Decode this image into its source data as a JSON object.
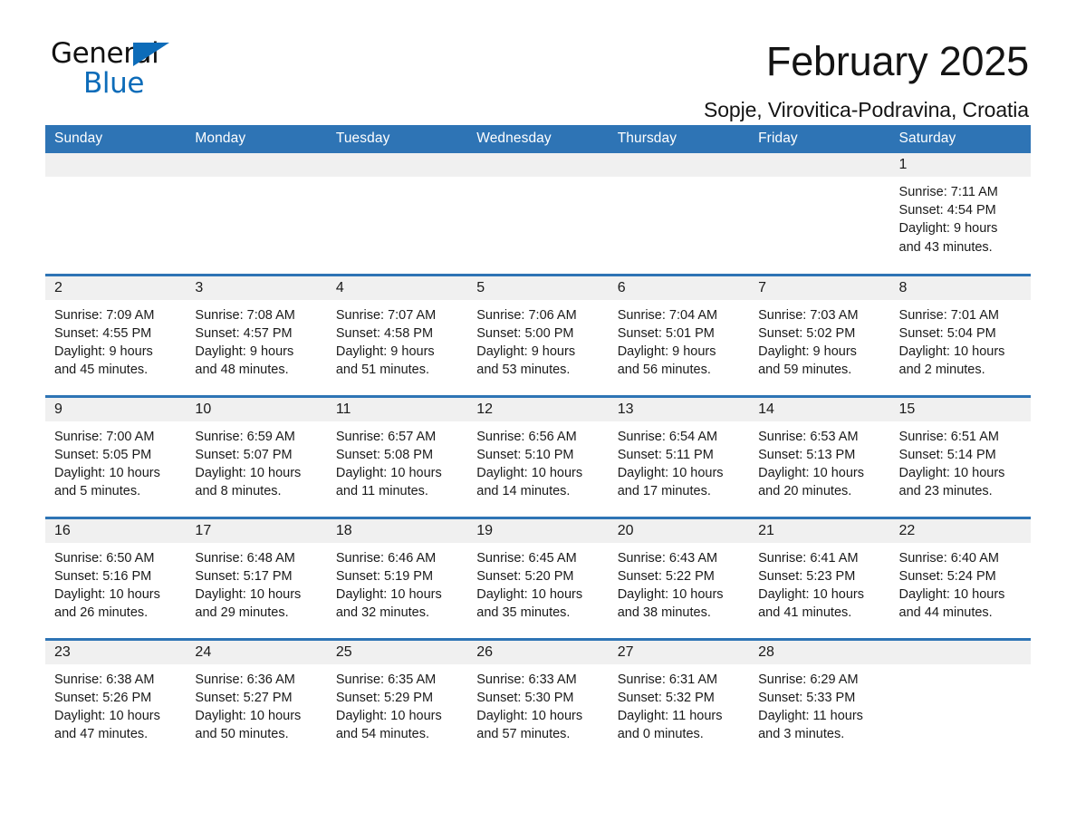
{
  "brand": {
    "word_one": "General",
    "word_two": "Blue",
    "accent_color": "#0d6cb9"
  },
  "header": {
    "title": "February 2025",
    "location": "Sopje, Virovitica-Podravina, Croatia",
    "header_bg_color": "#2e74b5",
    "daynum_band_color": "#f0f0f0"
  },
  "weekday_headers": [
    "Sunday",
    "Monday",
    "Tuesday",
    "Wednesday",
    "Thursday",
    "Friday",
    "Saturday"
  ],
  "weeks": [
    [
      {
        "day": "",
        "sunrise": "",
        "sunset": "",
        "daylight_line1": "",
        "daylight_line2": ""
      },
      {
        "day": "",
        "sunrise": "",
        "sunset": "",
        "daylight_line1": "",
        "daylight_line2": ""
      },
      {
        "day": "",
        "sunrise": "",
        "sunset": "",
        "daylight_line1": "",
        "daylight_line2": ""
      },
      {
        "day": "",
        "sunrise": "",
        "sunset": "",
        "daylight_line1": "",
        "daylight_line2": ""
      },
      {
        "day": "",
        "sunrise": "",
        "sunset": "",
        "daylight_line1": "",
        "daylight_line2": ""
      },
      {
        "day": "",
        "sunrise": "",
        "sunset": "",
        "daylight_line1": "",
        "daylight_line2": ""
      },
      {
        "day": "1",
        "sunrise": "Sunrise: 7:11 AM",
        "sunset": "Sunset: 4:54 PM",
        "daylight_line1": "Daylight: 9 hours",
        "daylight_line2": "and 43 minutes."
      }
    ],
    [
      {
        "day": "2",
        "sunrise": "Sunrise: 7:09 AM",
        "sunset": "Sunset: 4:55 PM",
        "daylight_line1": "Daylight: 9 hours",
        "daylight_line2": "and 45 minutes."
      },
      {
        "day": "3",
        "sunrise": "Sunrise: 7:08 AM",
        "sunset": "Sunset: 4:57 PM",
        "daylight_line1": "Daylight: 9 hours",
        "daylight_line2": "and 48 minutes."
      },
      {
        "day": "4",
        "sunrise": "Sunrise: 7:07 AM",
        "sunset": "Sunset: 4:58 PM",
        "daylight_line1": "Daylight: 9 hours",
        "daylight_line2": "and 51 minutes."
      },
      {
        "day": "5",
        "sunrise": "Sunrise: 7:06 AM",
        "sunset": "Sunset: 5:00 PM",
        "daylight_line1": "Daylight: 9 hours",
        "daylight_line2": "and 53 minutes."
      },
      {
        "day": "6",
        "sunrise": "Sunrise: 7:04 AM",
        "sunset": "Sunset: 5:01 PM",
        "daylight_line1": "Daylight: 9 hours",
        "daylight_line2": "and 56 minutes."
      },
      {
        "day": "7",
        "sunrise": "Sunrise: 7:03 AM",
        "sunset": "Sunset: 5:02 PM",
        "daylight_line1": "Daylight: 9 hours",
        "daylight_line2": "and 59 minutes."
      },
      {
        "day": "8",
        "sunrise": "Sunrise: 7:01 AM",
        "sunset": "Sunset: 5:04 PM",
        "daylight_line1": "Daylight: 10 hours",
        "daylight_line2": "and 2 minutes."
      }
    ],
    [
      {
        "day": "9",
        "sunrise": "Sunrise: 7:00 AM",
        "sunset": "Sunset: 5:05 PM",
        "daylight_line1": "Daylight: 10 hours",
        "daylight_line2": "and 5 minutes."
      },
      {
        "day": "10",
        "sunrise": "Sunrise: 6:59 AM",
        "sunset": "Sunset: 5:07 PM",
        "daylight_line1": "Daylight: 10 hours",
        "daylight_line2": "and 8 minutes."
      },
      {
        "day": "11",
        "sunrise": "Sunrise: 6:57 AM",
        "sunset": "Sunset: 5:08 PM",
        "daylight_line1": "Daylight: 10 hours",
        "daylight_line2": "and 11 minutes."
      },
      {
        "day": "12",
        "sunrise": "Sunrise: 6:56 AM",
        "sunset": "Sunset: 5:10 PM",
        "daylight_line1": "Daylight: 10 hours",
        "daylight_line2": "and 14 minutes."
      },
      {
        "day": "13",
        "sunrise": "Sunrise: 6:54 AM",
        "sunset": "Sunset: 5:11 PM",
        "daylight_line1": "Daylight: 10 hours",
        "daylight_line2": "and 17 minutes."
      },
      {
        "day": "14",
        "sunrise": "Sunrise: 6:53 AM",
        "sunset": "Sunset: 5:13 PM",
        "daylight_line1": "Daylight: 10 hours",
        "daylight_line2": "and 20 minutes."
      },
      {
        "day": "15",
        "sunrise": "Sunrise: 6:51 AM",
        "sunset": "Sunset: 5:14 PM",
        "daylight_line1": "Daylight: 10 hours",
        "daylight_line2": "and 23 minutes."
      }
    ],
    [
      {
        "day": "16",
        "sunrise": "Sunrise: 6:50 AM",
        "sunset": "Sunset: 5:16 PM",
        "daylight_line1": "Daylight: 10 hours",
        "daylight_line2": "and 26 minutes."
      },
      {
        "day": "17",
        "sunrise": "Sunrise: 6:48 AM",
        "sunset": "Sunset: 5:17 PM",
        "daylight_line1": "Daylight: 10 hours",
        "daylight_line2": "and 29 minutes."
      },
      {
        "day": "18",
        "sunrise": "Sunrise: 6:46 AM",
        "sunset": "Sunset: 5:19 PM",
        "daylight_line1": "Daylight: 10 hours",
        "daylight_line2": "and 32 minutes."
      },
      {
        "day": "19",
        "sunrise": "Sunrise: 6:45 AM",
        "sunset": "Sunset: 5:20 PM",
        "daylight_line1": "Daylight: 10 hours",
        "daylight_line2": "and 35 minutes."
      },
      {
        "day": "20",
        "sunrise": "Sunrise: 6:43 AM",
        "sunset": "Sunset: 5:22 PM",
        "daylight_line1": "Daylight: 10 hours",
        "daylight_line2": "and 38 minutes."
      },
      {
        "day": "21",
        "sunrise": "Sunrise: 6:41 AM",
        "sunset": "Sunset: 5:23 PM",
        "daylight_line1": "Daylight: 10 hours",
        "daylight_line2": "and 41 minutes."
      },
      {
        "day": "22",
        "sunrise": "Sunrise: 6:40 AM",
        "sunset": "Sunset: 5:24 PM",
        "daylight_line1": "Daylight: 10 hours",
        "daylight_line2": "and 44 minutes."
      }
    ],
    [
      {
        "day": "23",
        "sunrise": "Sunrise: 6:38 AM",
        "sunset": "Sunset: 5:26 PM",
        "daylight_line1": "Daylight: 10 hours",
        "daylight_line2": "and 47 minutes."
      },
      {
        "day": "24",
        "sunrise": "Sunrise: 6:36 AM",
        "sunset": "Sunset: 5:27 PM",
        "daylight_line1": "Daylight: 10 hours",
        "daylight_line2": "and 50 minutes."
      },
      {
        "day": "25",
        "sunrise": "Sunrise: 6:35 AM",
        "sunset": "Sunset: 5:29 PM",
        "daylight_line1": "Daylight: 10 hours",
        "daylight_line2": "and 54 minutes."
      },
      {
        "day": "26",
        "sunrise": "Sunrise: 6:33 AM",
        "sunset": "Sunset: 5:30 PM",
        "daylight_line1": "Daylight: 10 hours",
        "daylight_line2": "and 57 minutes."
      },
      {
        "day": "27",
        "sunrise": "Sunrise: 6:31 AM",
        "sunset": "Sunset: 5:32 PM",
        "daylight_line1": "Daylight: 11 hours",
        "daylight_line2": "and 0 minutes."
      },
      {
        "day": "28",
        "sunrise": "Sunrise: 6:29 AM",
        "sunset": "Sunset: 5:33 PM",
        "daylight_line1": "Daylight: 11 hours",
        "daylight_line2": "and 3 minutes."
      },
      {
        "day": "",
        "sunrise": "",
        "sunset": "",
        "daylight_line1": "",
        "daylight_line2": ""
      }
    ]
  ]
}
